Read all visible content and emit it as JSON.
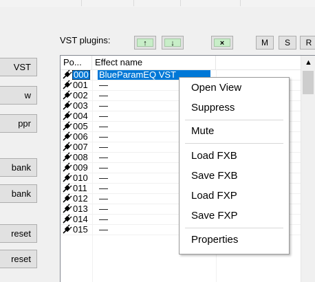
{
  "left_buttons": [
    {
      "label": "VST"
    },
    {
      "label": "w"
    },
    {
      "label": "ppr"
    },
    {
      "label": "bank"
    },
    {
      "label": "bank"
    },
    {
      "label": "reset"
    },
    {
      "label": "reset"
    }
  ],
  "toolbar": {
    "label": "VST plugins:",
    "up_label": "↑",
    "down_label": "↓",
    "remove_label": "×",
    "m_label": "M",
    "s_label": "S",
    "r_label": "R"
  },
  "list": {
    "columns": [
      "Po...",
      "Effect name"
    ],
    "rows": [
      {
        "num": "000",
        "name": "BlueParamEQ VST",
        "selected": true
      },
      {
        "num": "001",
        "name": "—"
      },
      {
        "num": "002",
        "name": "—"
      },
      {
        "num": "003",
        "name": "—"
      },
      {
        "num": "004",
        "name": "—"
      },
      {
        "num": "005",
        "name": "—"
      },
      {
        "num": "006",
        "name": "—"
      },
      {
        "num": "007",
        "name": "—"
      },
      {
        "num": "008",
        "name": "—"
      },
      {
        "num": "009",
        "name": "—"
      },
      {
        "num": "010",
        "name": "—"
      },
      {
        "num": "011",
        "name": "—"
      },
      {
        "num": "012",
        "name": "—"
      },
      {
        "num": "013",
        "name": "—"
      },
      {
        "num": "014",
        "name": "—"
      },
      {
        "num": "015",
        "name": "—"
      }
    ],
    "scroll_up_glyph": "▲"
  },
  "context_menu": {
    "items": [
      "Open View",
      "Suppress",
      "Mute",
      "Load FXB",
      "Save FXB",
      "Load FXP",
      "Save FXP",
      "Properties"
    ]
  },
  "colors": {
    "selection": "#0078d7",
    "button_face": "#e1e1e1",
    "green_inner": "#c8eec8"
  }
}
